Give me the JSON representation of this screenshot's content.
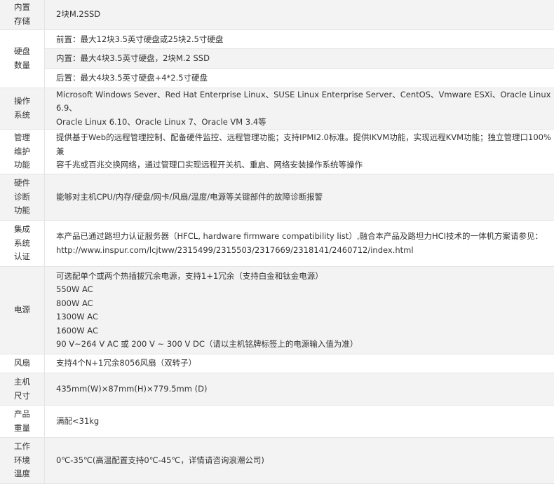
{
  "rows": [
    {
      "label": "内置\n存储",
      "values": [
        "2块M.2SSD"
      ]
    },
    {
      "label": "硬盘\n数量",
      "sub": [
        "前置：最大12块3.5英寸硬盘或25块2.5寸硬盘",
        "内置：最大4块3.5英寸硬盘，2块M.2 SSD",
        "后置：最大4块3.5英寸硬盘+4*2.5寸硬盘"
      ]
    },
    {
      "label": "操作\n系统",
      "values": [
        "Microsoft Windows Sever、Red Hat Enterprise Linux、SUSE Linux Enterprise Server、CentOS、Vmware ESXi、Oracle Linux 6.9、",
        "Oracle Linux 6.10、Oracle Linux 7、Oracle VM 3.4等"
      ]
    },
    {
      "label": "管理\n维护\n功能",
      "values": [
        "提供基于Web的远程管理控制、配备硬件监控、远程管理功能；支持IPMI2.0标准。提供IKVM功能，实现远程KVM功能；独立管理口100%兼",
        "容千兆或百兆交换网络，通过管理口实现远程开关机、重启、网络安装操作系统等操作"
      ]
    },
    {
      "label": "硬件\n诊断\n功能",
      "values": [
        "能够对主机CPU/内存/硬盘/网卡/风扇/温度/电源等关键部件的故障诊断报警"
      ]
    },
    {
      "label": "集成\n系统\n认证",
      "values": [
        "本产品已通过路坦力认证服务器（HFCL, hardware firmware compatibility list）,融合本产品及路坦力HCI技术的一体机方案请参见：",
        "http://www.inspur.com/lcjtww/2315499/2315503/2317669/2318141/2460712/index.html"
      ]
    },
    {
      "label": "电源",
      "values": [
        "可选配单个或两个热插拔冗余电源，支持1+1冗余（支持白金和钛金电源）",
        "550W AC",
        "800W AC",
        "1300W AC",
        "1600W AC",
        "90 V~264 V AC 或 200 V ~ 300 V DC（请以主机铭牌标签上的电源输入值为准）"
      ]
    },
    {
      "label": "风扇",
      "values": [
        "支持4个N+1冗余8056风扇（双转子）"
      ]
    },
    {
      "label": "主机\n尺寸",
      "values": [
        "435mm(W)×87mm(H)×779.5mm (D)"
      ]
    },
    {
      "label": "产品\n重量",
      "values": [
        "满配<31kg"
      ]
    },
    {
      "label": "工作\n环境\n温度",
      "values": [
        "0℃-35℃(高温配置支持0℃-45℃，详情请咨询浪潮公司)"
      ]
    }
  ]
}
